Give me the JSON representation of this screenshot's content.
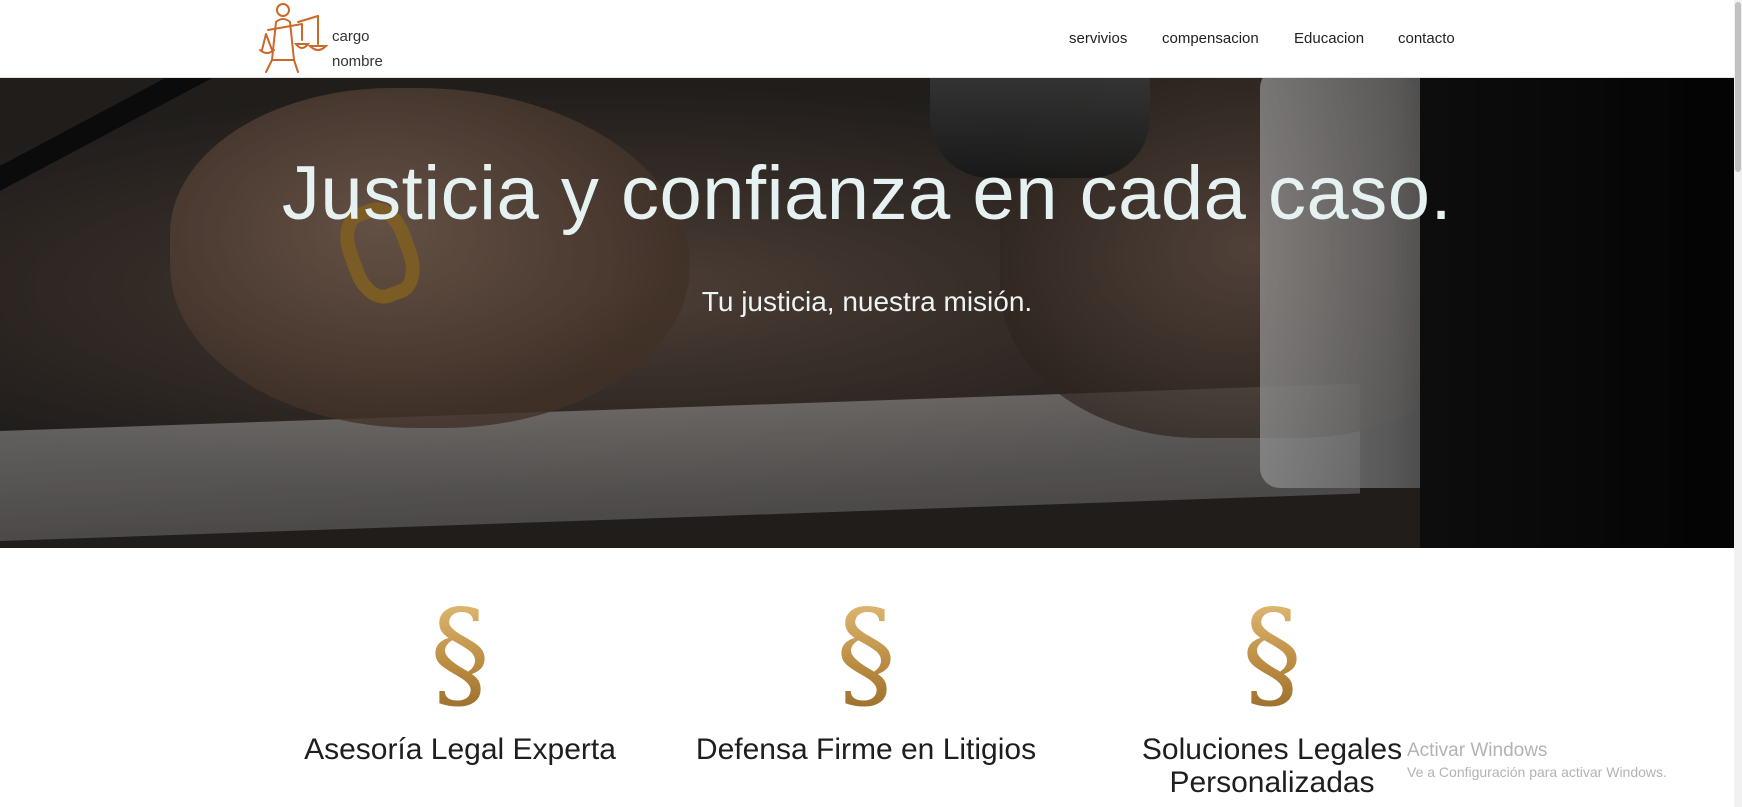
{
  "header": {
    "brand_line1": "cargo",
    "brand_line2": "nombre",
    "nav": [
      {
        "label": "servivios"
      },
      {
        "label": "compensacion"
      },
      {
        "label": "Educacion"
      },
      {
        "label": "contacto"
      }
    ]
  },
  "hero": {
    "title": "Justicia y confianza en cada caso.",
    "subtitle": "Tu justicia, nuestra misión."
  },
  "services": [
    {
      "icon": "§",
      "title": "Asesoría Legal Experta"
    },
    {
      "icon": "§",
      "title": "Defensa Firme en Litigios"
    },
    {
      "icon": "§",
      "title": "Soluciones Legales Personalizadas"
    }
  ],
  "watermark": {
    "title": "Activar Windows",
    "subtitle": "Ve a Configuración para activar Windows."
  },
  "colors": {
    "accent_gold": "#b7863d",
    "logo_orange": "#c9692a",
    "hero_text": "#e6f1f1"
  }
}
